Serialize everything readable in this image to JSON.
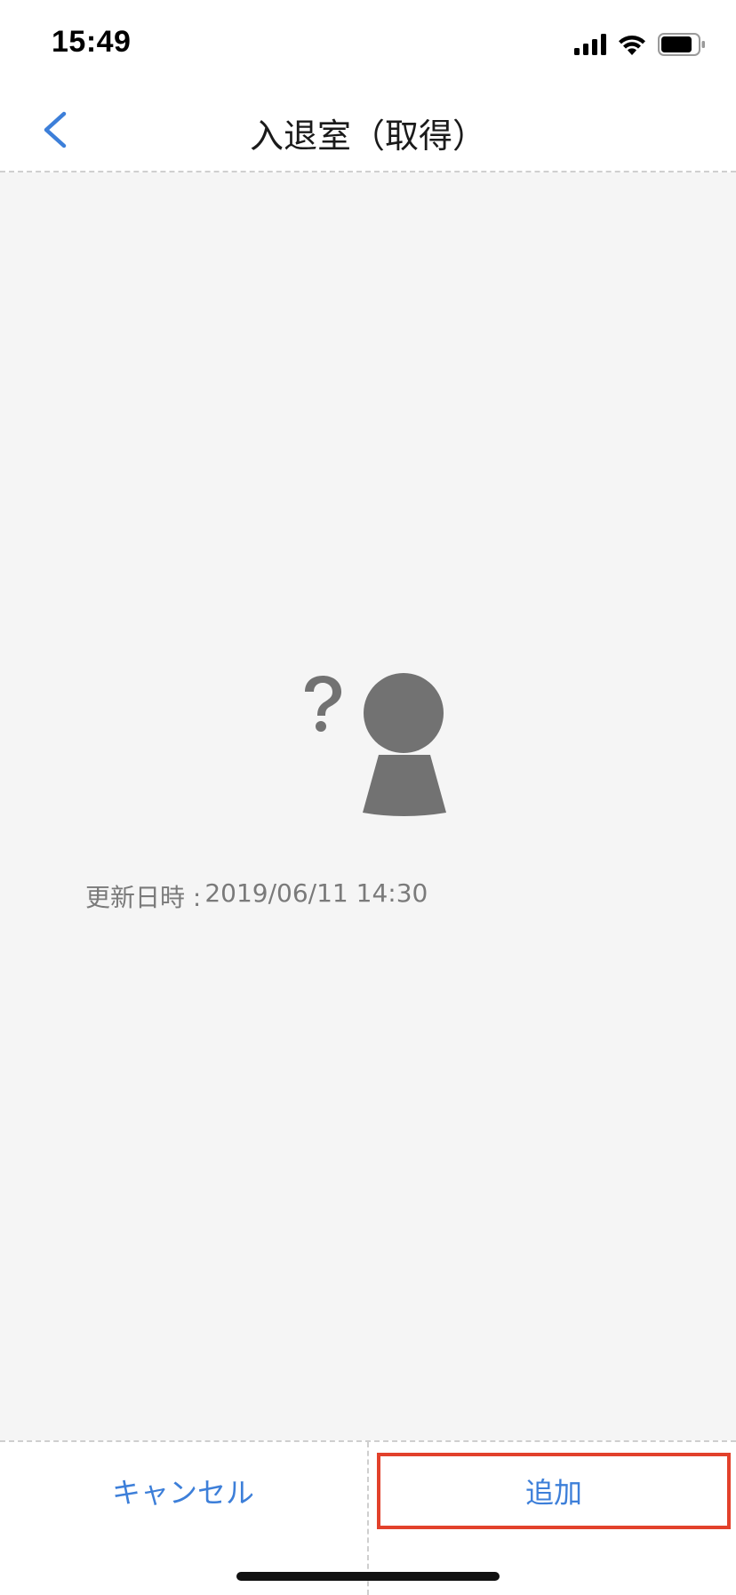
{
  "status_bar": {
    "time": "15:49",
    "icons": [
      "cellular-signal-icon",
      "wifi-icon",
      "battery-icon"
    ]
  },
  "nav": {
    "back_icon": "chevron-left-icon",
    "title": "入退室（取得）"
  },
  "main": {
    "avatar_icon": "unknown-person-icon",
    "updated_label": "更新日時 :",
    "updated_value": "2019/06/11 14:30"
  },
  "actions": {
    "cancel_label": "キャンセル",
    "add_label": "追加"
  },
  "colors": {
    "accent": "#3d7fd9",
    "highlight_border": "#e2412b",
    "background": "#f5f5f5",
    "icon_gray": "#727272"
  }
}
